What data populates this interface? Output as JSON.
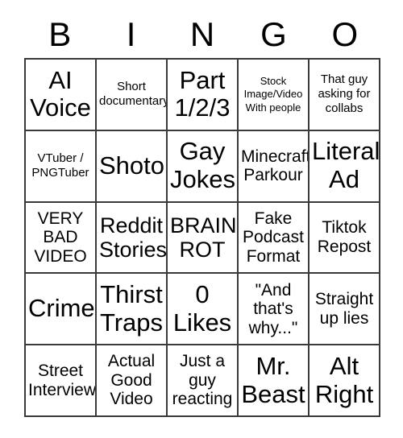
{
  "card": {
    "header_letters": [
      "B",
      "I",
      "N",
      "G",
      "O"
    ],
    "cells": [
      {
        "text": "AI\nVoice",
        "size": "xl"
      },
      {
        "text": "Short\ndocumentary",
        "size": "sm"
      },
      {
        "text": "Part\n1/2/3",
        "size": "xl"
      },
      {
        "text": "Stock\nImage/Video\nWith people",
        "size": "xs"
      },
      {
        "text": "That guy\nasking for\ncollabs",
        "size": "sm"
      },
      {
        "text": "VTuber /\nPNGTuber",
        "size": "sm"
      },
      {
        "text": "Shoto",
        "size": "xl"
      },
      {
        "text": "Gay\nJokes",
        "size": "xl"
      },
      {
        "text": "Minecraft\nParkour",
        "size": "md"
      },
      {
        "text": "Literal\nAd",
        "size": "xl"
      },
      {
        "text": "VERY\nBAD\nVIDEO",
        "size": "md"
      },
      {
        "text": "Reddit\nStories",
        "size": "lg"
      },
      {
        "text": "BRAIN\nROT",
        "size": "lg"
      },
      {
        "text": "Fake\nPodcast\nFormat",
        "size": "md"
      },
      {
        "text": "Tiktok\nRepost",
        "size": "md"
      },
      {
        "text": "Crime",
        "size": "xl"
      },
      {
        "text": "Thirst\nTraps",
        "size": "xl"
      },
      {
        "text": "0\nLikes",
        "size": "xl"
      },
      {
        "text": "\"And\nthat's\nwhy...\"",
        "size": "md"
      },
      {
        "text": "Straight\nup lies",
        "size": "md"
      },
      {
        "text": "Street\nInterview",
        "size": "md"
      },
      {
        "text": "Actual\nGood\nVideo",
        "size": "md"
      },
      {
        "text": "Just a\nguy\nreacting",
        "size": "md"
      },
      {
        "text": "Mr.\nBeast",
        "size": "xl"
      },
      {
        "text": "Alt\nRight",
        "size": "xl"
      }
    ]
  }
}
